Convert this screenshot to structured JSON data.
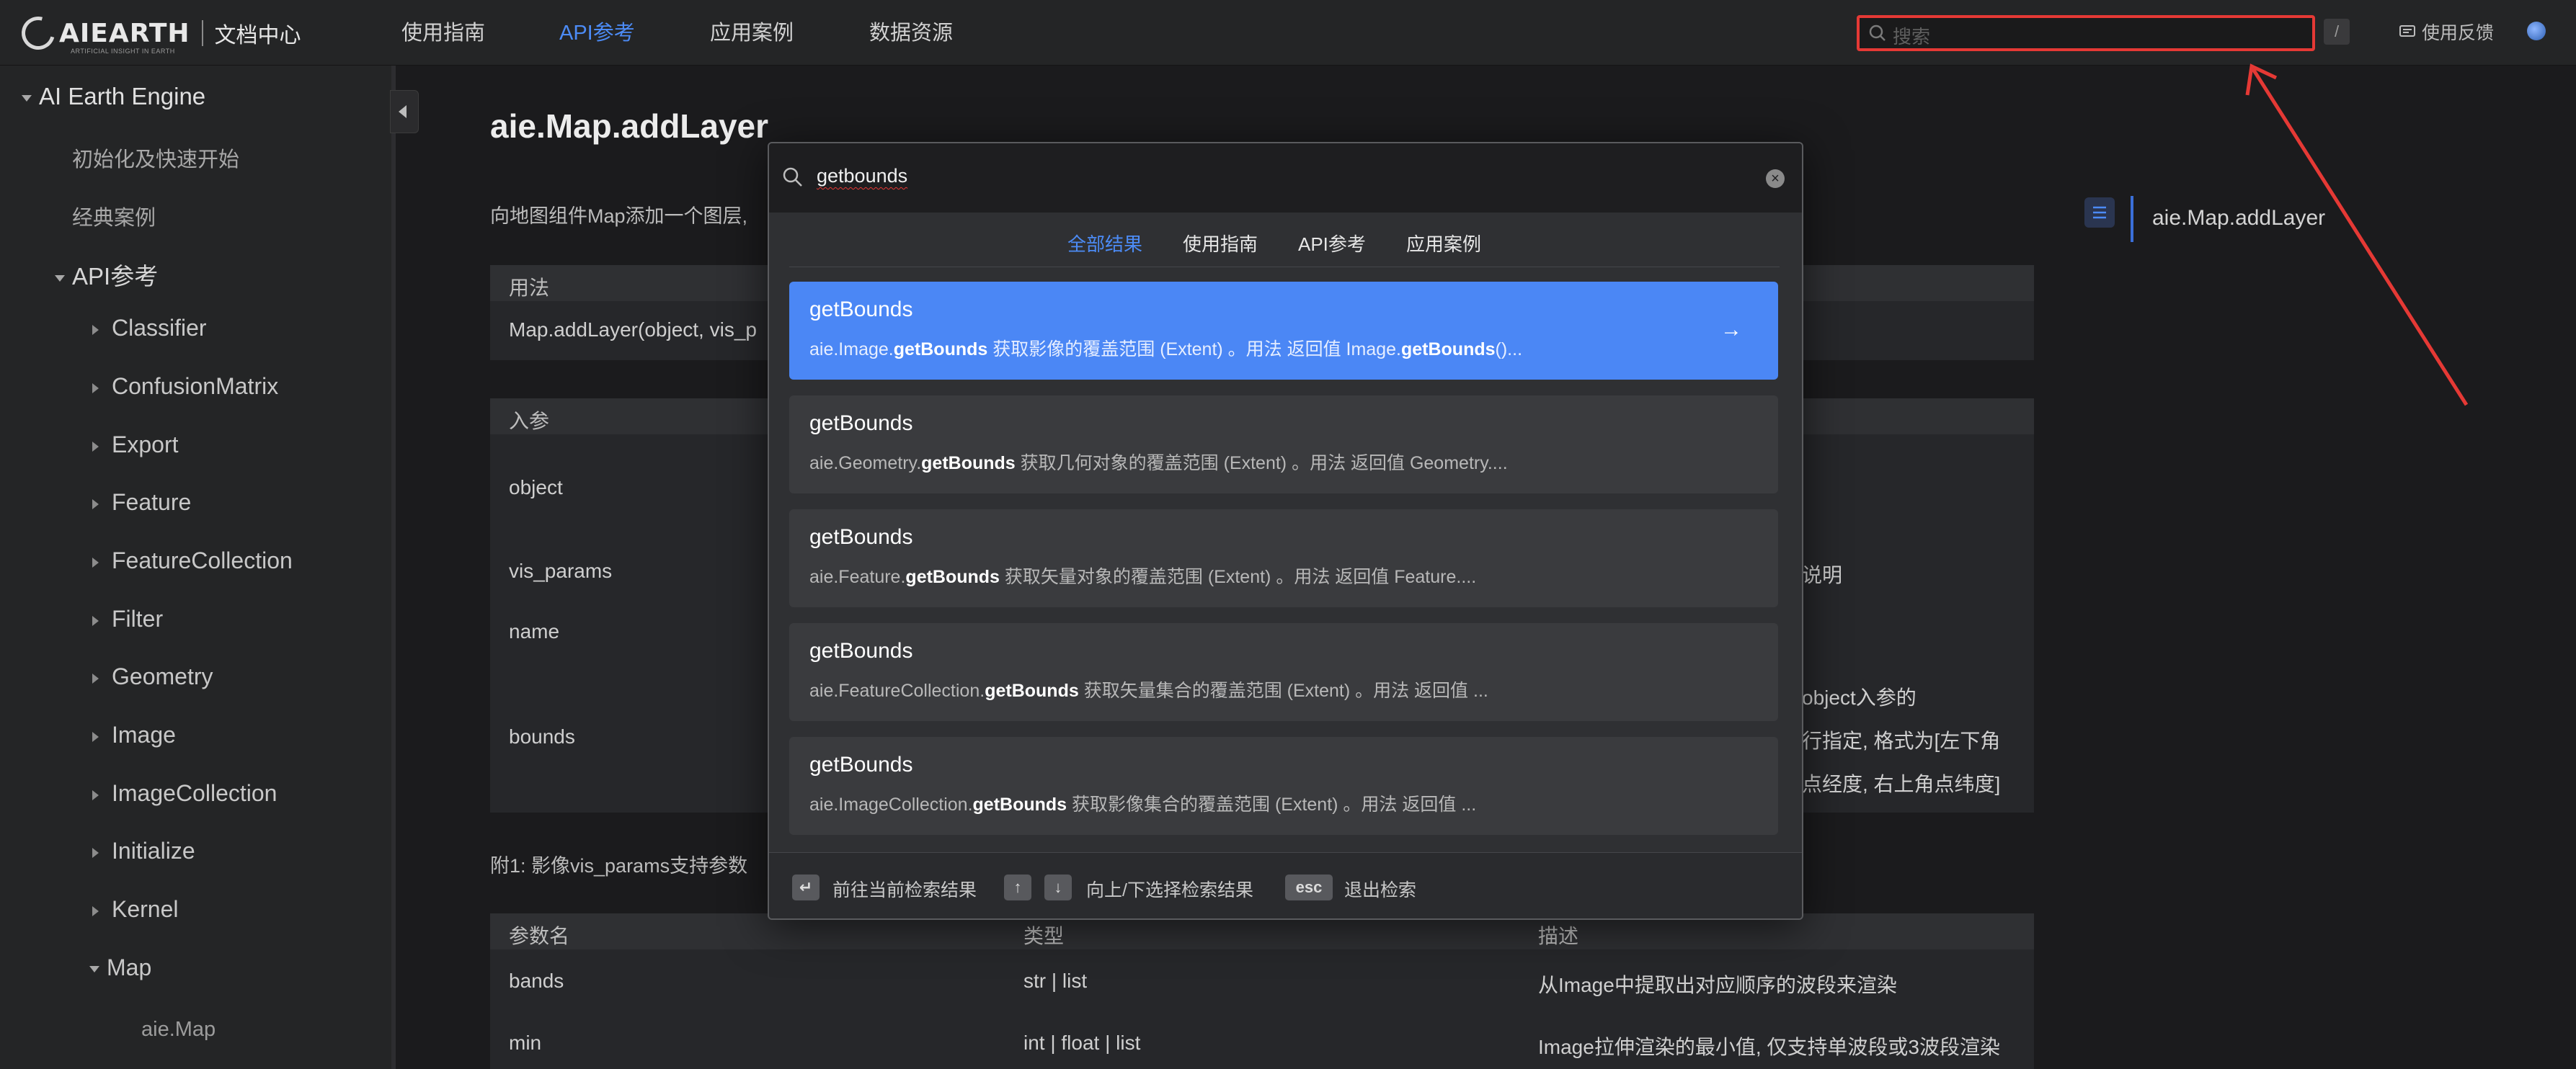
{
  "header": {
    "logo_text": "AIEARTH",
    "logo_subtitle": "ARTIFICIAL INSIGHT IN EARTH",
    "doc_center": "文档中心",
    "nav": [
      "使用指南",
      "API参考",
      "应用案例",
      "数据资源"
    ],
    "active_nav": "API参考",
    "search_placeholder": "搜索",
    "search_shortcut": "/",
    "feedback": "使用反馈"
  },
  "sidebar": {
    "root": "AI Earth Engine",
    "items": [
      "初始化及快速开始",
      "经典案例"
    ],
    "api_section": "API参考",
    "api_items": [
      "Classifier",
      "ConfusionMatrix",
      "Export",
      "Feature",
      "FeatureCollection",
      "Filter",
      "Geometry",
      "Image",
      "ImageCollection",
      "Initialize",
      "Kernel",
      "Map"
    ],
    "map_child": "aie.Map"
  },
  "doc": {
    "title": "aie.Map.addLayer",
    "description": "向地图组件Map添加一个图层,",
    "usage_header": "用法",
    "usage_code": "Map.addLayer(object, vis_p",
    "params_header": "入参",
    "params": [
      "object",
      "vis_params",
      "name",
      "bounds"
    ],
    "right_fragments": [
      "说明",
      "object入参的",
      "行指定, 格式为[左下角",
      "点经度, 右上角点纬度]"
    ],
    "note": "附1: 影像vis_params支持参数",
    "table2_headers": [
      "参数名",
      "类型",
      "描述"
    ],
    "table2_rows": [
      [
        "bands",
        "str | list",
        "从Image中提取出对应顺序的波段来渲染"
      ],
      [
        "min",
        "int | float | list",
        "Image拉伸渲染的最小值, 仅支持单波段或3波段渲染"
      ]
    ],
    "toc_item": "aie.Map.addLayer"
  },
  "search_modal": {
    "query": "getbounds",
    "clear_icon": "×",
    "tabs": [
      "全部结果",
      "使用指南",
      "API参考",
      "应用案例"
    ],
    "active_tab": "全部结果",
    "results": [
      {
        "title": "getBounds",
        "prefix": "aie.Image.",
        "match": "getBounds",
        "rest": " 获取影像的覆盖范围 (Extent) 。用法 返回值 Image.",
        "match2": "getBounds",
        "tail": "()..."
      },
      {
        "title": "getBounds",
        "prefix": "aie.Geometry.",
        "match": "getBounds",
        "rest": " 获取几何对象的覆盖范围 (Extent) 。用法 返回值 Geometry....",
        "match2": "",
        "tail": ""
      },
      {
        "title": "getBounds",
        "prefix": "aie.Feature.",
        "match": "getBounds",
        "rest": " 获取矢量对象的覆盖范围 (Extent) 。用法 返回值 Feature....",
        "match2": "",
        "tail": ""
      },
      {
        "title": "getBounds",
        "prefix": "aie.FeatureCollection.",
        "match": "getBounds",
        "rest": " 获取矢量集合的覆盖范围 (Extent) 。用法 返回值 ...",
        "match2": "",
        "tail": ""
      },
      {
        "title": "getBounds",
        "prefix": "aie.ImageCollection.",
        "match": "getBounds",
        "rest": " 获取影像集合的覆盖范围 (Extent) 。用法 返回值 ...",
        "match2": "",
        "tail": ""
      }
    ],
    "result_arrow": "→",
    "footer": {
      "enter_key": "↵",
      "enter_label": "前往当前检索结果",
      "up_key": "↑",
      "down_key": "↓",
      "nav_label": "向上/下选择检索结果",
      "esc_key": "esc",
      "esc_label": "退出检索"
    }
  },
  "colors": {
    "accent": "#4c8bf5",
    "annotation": "#e53935"
  }
}
